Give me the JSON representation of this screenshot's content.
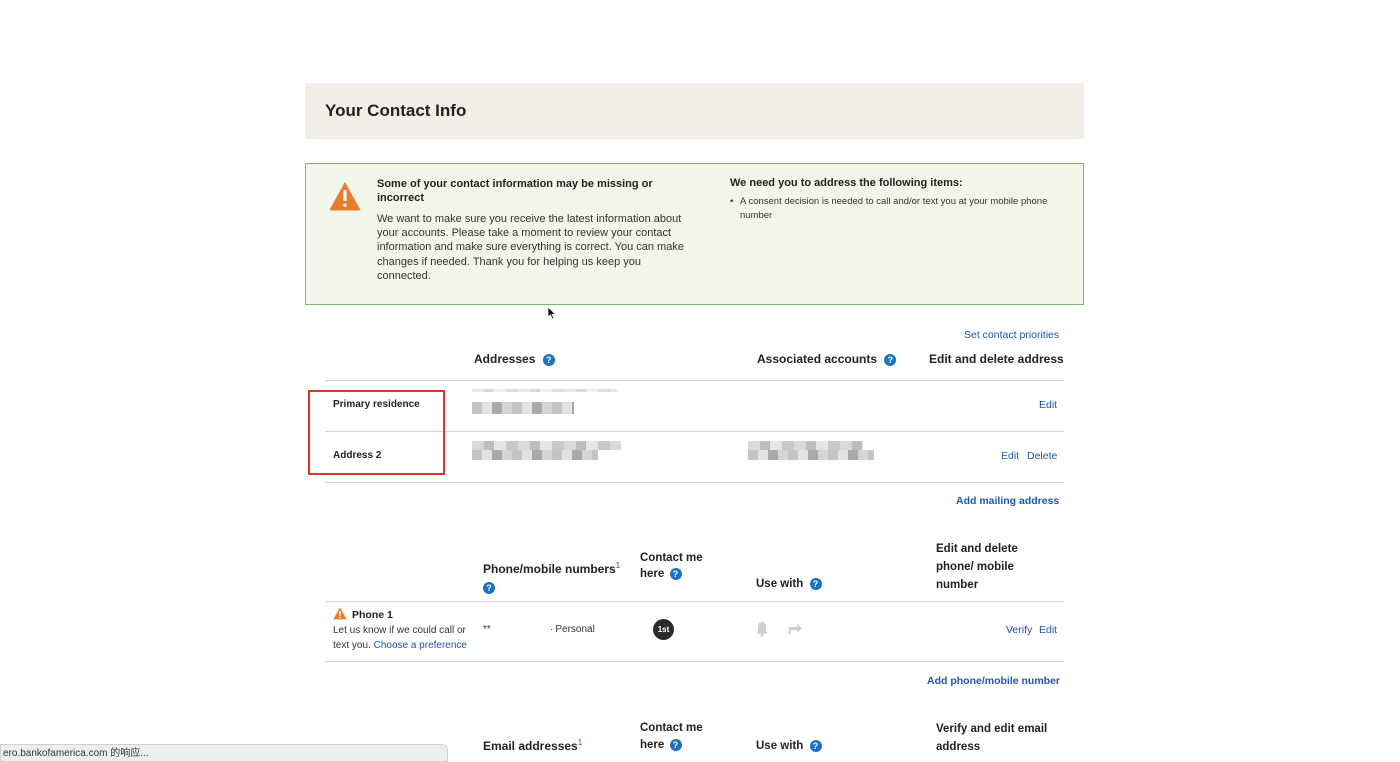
{
  "header": {
    "title": "Your Contact Info"
  },
  "alert": {
    "heading": "Some of your contact information may be missing or incorrect",
    "body": "We want to make sure you receive the latest information about your accounts. Please take a moment to review your contact information and make sure everything is correct. You can make changes if needed. Thank you for helping us keep you connected.",
    "right_heading": "We need you to address the following items:",
    "right_items": [
      "A consent decision is needed to call and/or text you at your mobile phone number"
    ]
  },
  "addresses": {
    "set_priorities_link": "Set contact priorities",
    "col_addresses": "Addresses",
    "col_accounts": "Associated accounts",
    "col_edit": "Edit and delete address",
    "rows": [
      {
        "label": "Primary residence",
        "edit": "Edit"
      },
      {
        "label": "Address 2",
        "edit": "Edit",
        "delete": "Delete"
      }
    ],
    "add_link": "Add mailing address"
  },
  "phones": {
    "col_numbers": "Phone/mobile numbers",
    "col_numbers_sup": "1",
    "col_contact": "Contact me here",
    "col_use": "Use with",
    "col_edit": "Edit and delete phone/ mobile number",
    "rows": [
      {
        "name": "Phone 1",
        "desc": "Let us know if we could call or text you.",
        "desc_link": "Choose a preference",
        "number": "**",
        "type": "Personal",
        "badge": "1st",
        "verify": "Verify",
        "edit": "Edit"
      }
    ],
    "add_link": "Add phone/mobile number"
  },
  "emails": {
    "col_emails": "Email addresses",
    "col_emails_sup": "1",
    "col_contact": "Contact me here",
    "col_use": "Use with",
    "col_edit": "Verify and edit email address"
  },
  "status_bar": {
    "text": "ero.bankofamerica.com 的响应..."
  },
  "colors": {
    "link": "#1f56a8",
    "help": "#1b72c2",
    "warning": "#e87d2e",
    "alert_border": "#7fb46c",
    "highlight": "#d9352a"
  },
  "icons": [
    "warning-icon",
    "help-icon",
    "bell-icon",
    "swap-arrows-icon",
    "cursor-icon"
  ]
}
